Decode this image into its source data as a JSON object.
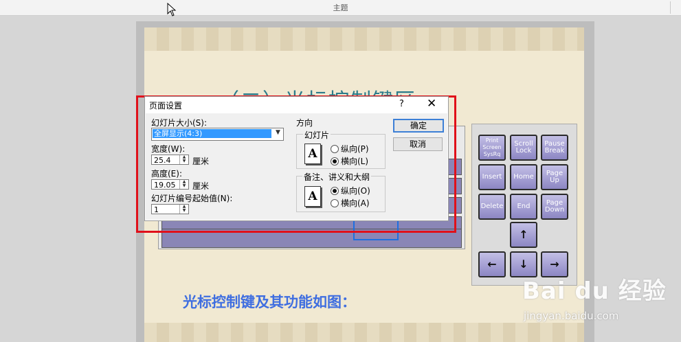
{
  "window": {
    "title": "主题"
  },
  "slide": {
    "title": "（二）光标控制键区",
    "caption": "光标控制键及其功能如图："
  },
  "nav_keys": {
    "print": "Print Screen SysRq",
    "scroll": "Scroll Lock",
    "pause": "Pause Break",
    "insert": "Insert",
    "home": "Home",
    "pageup": "Page Up",
    "delete": "Delete",
    "end": "End",
    "pagedown": "Page Down",
    "up": "↑",
    "left": "←",
    "down": "↓",
    "right": "→"
  },
  "dialog": {
    "title": "页面设置",
    "help": "?",
    "close": "✕",
    "slide_size_label": "幻灯片大小(S):",
    "slide_size_value": "全屏显示(4:3)",
    "width_label": "宽度(W):",
    "width_value": "25.4",
    "height_label": "高度(E):",
    "height_value": "19.05",
    "unit": "厘米",
    "start_number_label": "幻灯片编号起始值(N):",
    "start_number_value": "1",
    "orientation_label": "方向",
    "slides_group_label": "幻灯片",
    "notes_group_label": "备注、讲义和大纲",
    "portrait_p": "纵向(P)",
    "landscape_l": "横向(L)",
    "portrait_o": "纵向(O)",
    "landscape_a": "横向(A)",
    "ok": "确定",
    "cancel": "取消",
    "icon_letter": "A"
  },
  "watermark": {
    "brand": "Bai du 经验",
    "url": "jingyan.baidu.com"
  },
  "colors": {
    "red_highlight": "#e0101a",
    "caption_blue": "#3f6ee0",
    "title_teal": "#2b7b8a",
    "key_purple": "#8c86c3",
    "selection_blue": "#3399ff"
  }
}
